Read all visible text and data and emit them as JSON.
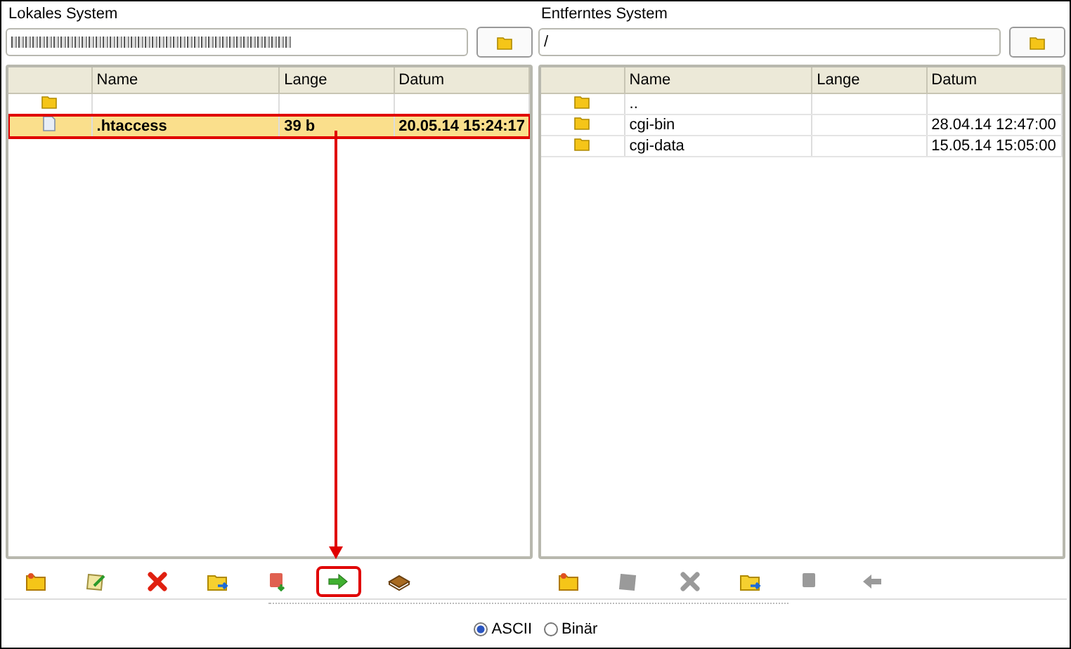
{
  "panes": [
    {
      "title": "Lokales System",
      "path": {
        "obscured": true
      },
      "columns": [
        "Name",
        "Lange",
        "Datum"
      ],
      "rows": [
        {
          "kind": "folder",
          "selected": false,
          "marked": false
        },
        {
          "kind": "file",
          "name": ".htaccess",
          "size": "39 b",
          "date": "20.05.14 15:24:17",
          "selected": true,
          "marked": true
        }
      ],
      "toolbar": [
        {
          "kind": "new-folder",
          "disabled": false,
          "marked": false
        },
        {
          "kind": "rename",
          "disabled": false,
          "marked": false
        },
        {
          "kind": "delete",
          "disabled": false,
          "marked": false
        },
        {
          "kind": "refresh",
          "disabled": false,
          "marked": false
        },
        {
          "kind": "stop",
          "disabled": false,
          "marked": false
        },
        {
          "kind": "arrow-right",
          "disabled": false,
          "marked": true
        },
        {
          "kind": "archive",
          "disabled": false,
          "marked": false
        }
      ]
    },
    {
      "title": "Entferntes System",
      "path": {
        "obscured": false,
        "value": "/"
      },
      "columns": [
        "Name",
        "Lange",
        "Datum"
      ],
      "rows": [
        {
          "kind": "folder",
          "name": "..",
          "selected": false,
          "marked": false
        },
        {
          "kind": "folder",
          "name": "cgi-bin",
          "date": "28.04.14 12:47:00",
          "selected": false,
          "marked": false
        },
        {
          "kind": "folder",
          "name": "cgi-data",
          "date": "15.05.14 15:05:00",
          "selected": false,
          "marked": false
        }
      ],
      "toolbar": [
        {
          "kind": "new-folder",
          "disabled": false,
          "marked": false
        },
        {
          "kind": "rename",
          "disabled": true,
          "marked": false
        },
        {
          "kind": "delete",
          "disabled": true,
          "marked": false
        },
        {
          "kind": "refresh",
          "disabled": false,
          "marked": false
        },
        {
          "kind": "stop",
          "disabled": true,
          "marked": false
        },
        {
          "kind": "arrow-left",
          "disabled": true,
          "marked": false
        }
      ]
    }
  ],
  "transfer_mode": [
    {
      "label": "ASCII",
      "selected": true
    },
    {
      "label": "Binär",
      "selected": false
    }
  ]
}
